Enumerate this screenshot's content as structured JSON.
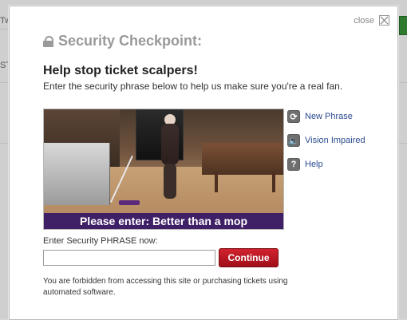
{
  "background": {
    "left_edge_text_1": "Tw",
    "left_edge_text_2": "ST"
  },
  "modal": {
    "close_label": "close",
    "title": "Security Checkpoint:",
    "headline": "Help stop ticket scalpers!",
    "subtext": "Enter the security phrase below to help us make sure you're a real fan.",
    "captcha_banner_text": "Please enter: Better than a mop",
    "actions": [
      {
        "label": "New Phrase",
        "icon": "refresh-icon"
      },
      {
        "label": "Vision Impaired",
        "icon": "speaker-icon"
      },
      {
        "label": "Help",
        "icon": "help-icon"
      }
    ],
    "field_label": "Enter Security PHRASE now:",
    "input_value": "",
    "continue_label": "Continue",
    "disclaimer": "You are forbidden from accessing this site or purchasing tickets using automated software."
  },
  "colors": {
    "banner_bg": "#3f1f66",
    "continue_red": "#c21b27",
    "link_blue": "#2b4b8f"
  }
}
